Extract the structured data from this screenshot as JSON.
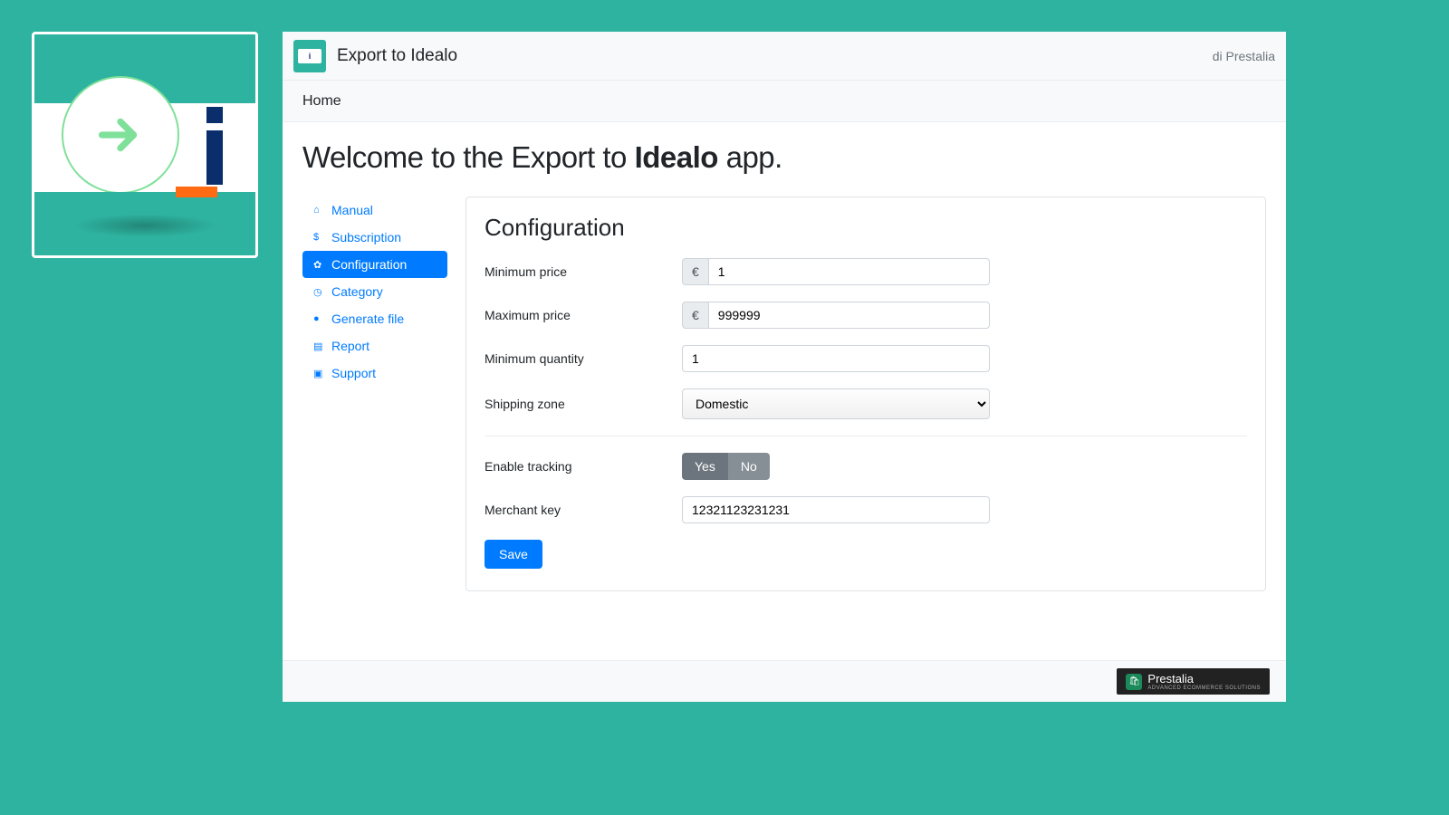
{
  "header": {
    "title": "Export to Idealo",
    "byline": "di Prestalia"
  },
  "breadcrumb": "Home",
  "welcome": {
    "prefix": "Welcome to the ",
    "mid": "Export to ",
    "bold": "Idealo",
    "suffix": " app."
  },
  "sidebar": {
    "items": [
      {
        "label": "Manual"
      },
      {
        "label": "Subscription"
      },
      {
        "label": "Configuration"
      },
      {
        "label": "Category"
      },
      {
        "label": "Generate file"
      },
      {
        "label": "Report"
      },
      {
        "label": "Support"
      }
    ]
  },
  "panel": {
    "title": "Configuration",
    "currency": "€",
    "labels": {
      "min_price": "Minimum price",
      "max_price": "Maximum price",
      "min_qty": "Minimum quantity",
      "shipping_zone": "Shipping zone",
      "enable_tracking": "Enable tracking",
      "merchant_key": "Merchant key"
    },
    "values": {
      "min_price": "1",
      "max_price": "999999",
      "min_qty": "1",
      "shipping_zone": "Domestic",
      "merchant_key": "12321123231231"
    },
    "toggle": {
      "yes": "Yes",
      "no": "No"
    },
    "save": "Save"
  },
  "footer": {
    "brand": "Prestalia",
    "tag": "ADVANCED ECOMMERCE SOLUTIONS"
  }
}
